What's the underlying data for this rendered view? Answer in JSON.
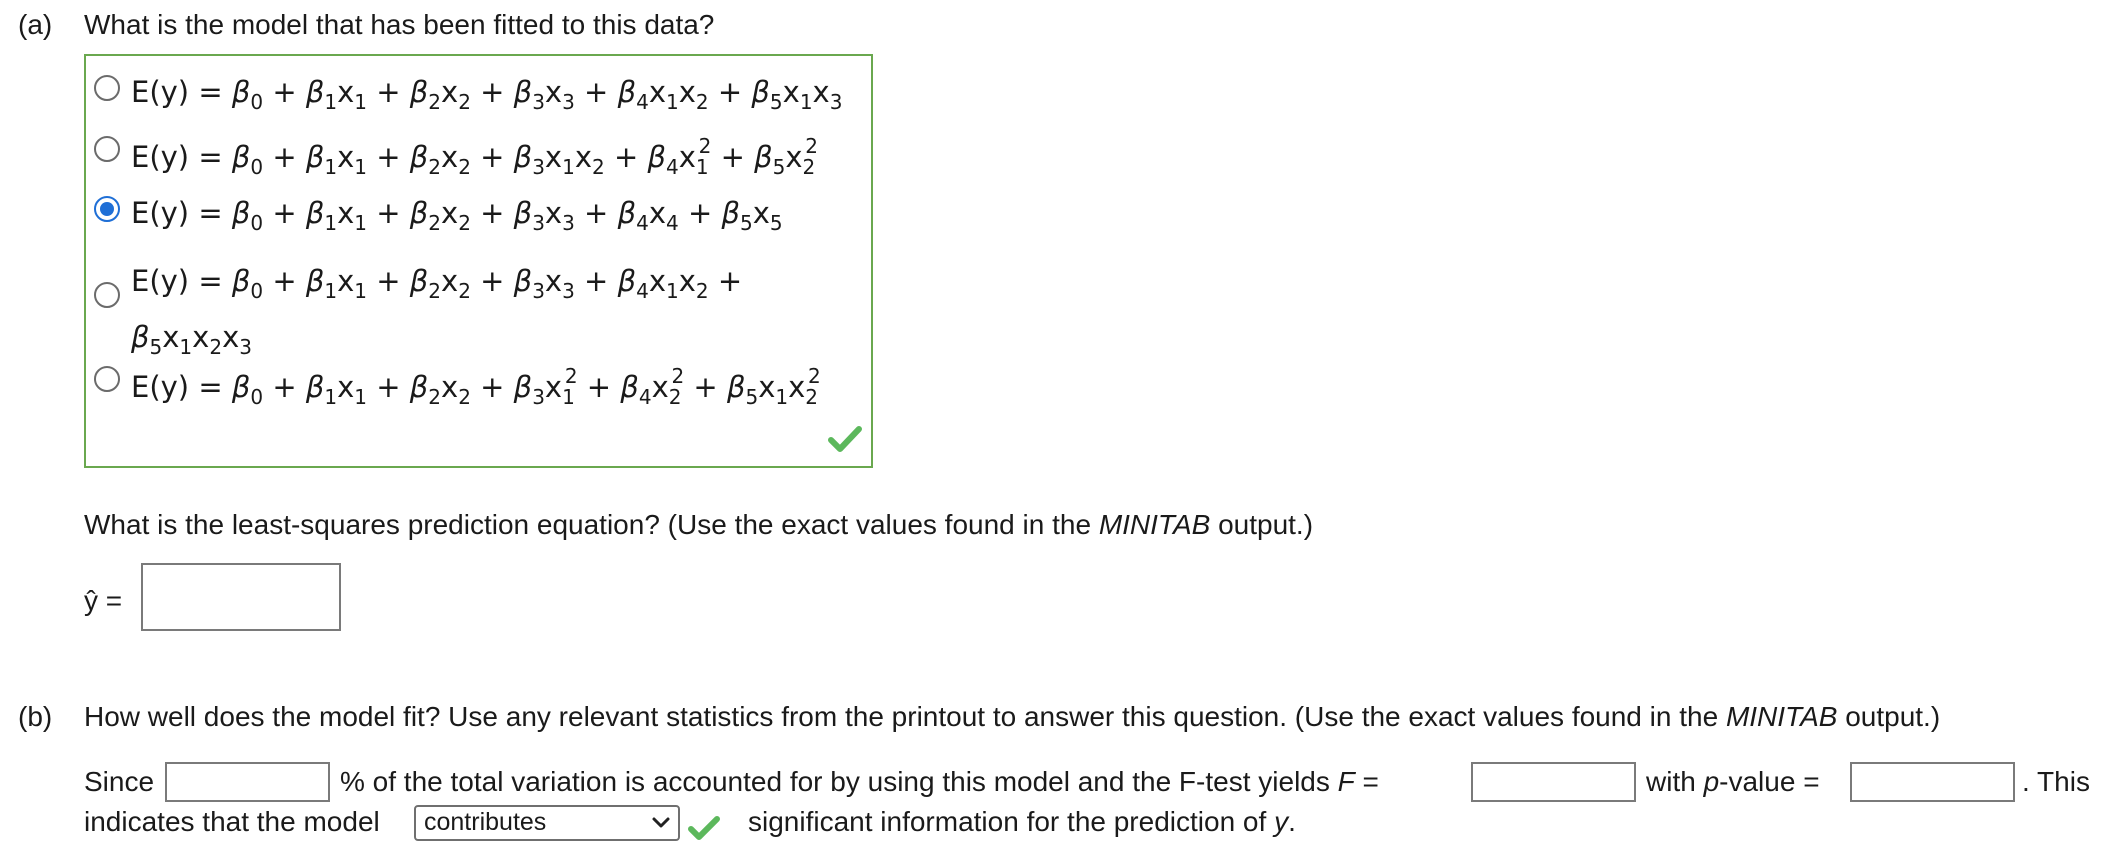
{
  "part_a": {
    "label": "(a)",
    "question": "What is the model that has been fitted to this data?",
    "choices": [
      {
        "selected": false
      },
      {
        "selected": false
      },
      {
        "selected": true
      },
      {
        "selected": false
      },
      {
        "selected": false
      }
    ],
    "prediction_prompt": {
      "pre": "What is the least-squares prediction equation? (Use the exact values found in the ",
      "italic": "MINITAB",
      "post": " output.)"
    },
    "yhat_label": "ŷ =",
    "yhat_value": ""
  },
  "part_b": {
    "label": "(b)",
    "question": {
      "pre": "How well does the model fit? Use any relevant statistics from the printout to answer this question. (Use the exact values found in the ",
      "italic": "MINITAB",
      "post": " output.)"
    },
    "since": "Since",
    "pct_text": "% of the total variation is accounted for by using this model and the F-test yields ",
    "f_symbol": "F",
    "eq": " =",
    "with_text": "with ",
    "p_symbol": "p",
    "pvalue_text": "-value =",
    "this_text": ". This",
    "indicates_text": "indicates that the model",
    "select_value": "contributes",
    "significant_text": "significant information for the prediction of ",
    "y_symbol": "y",
    "period": "."
  },
  "colors": {
    "check_green": "#5cb85c",
    "radio_blue": "#1f6fd6",
    "box_border_green": "#6aa84f"
  },
  "icons": [
    "checkmark-icon",
    "chevron-down-icon"
  ]
}
